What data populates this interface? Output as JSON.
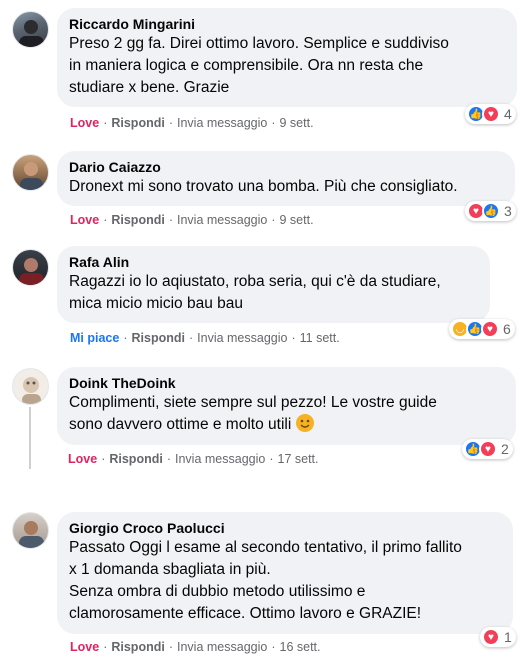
{
  "comments": [
    {
      "author": "Riccardo Mingarini",
      "lines": [
        "Preso 2 gg fa. Direi ottimo lavoro. Semplice e suddiviso",
        "in maniera logica e comprensibile. Ora nn resta che",
        "studiare x bene. Grazie"
      ],
      "reaction_label": "Love",
      "reply": "Rispondi",
      "message": "Invia messaggio",
      "time": "9 sett.",
      "reaction_icons": [
        "like-icon",
        "love-icon"
      ],
      "reaction_count": "4"
    },
    {
      "author": "Dario Caiazzo",
      "lines": [
        "Dronext mi sono trovato una bomba. Più che consigliato."
      ],
      "reaction_label": "Love",
      "reply": "Rispondi",
      "message": "Invia messaggio",
      "time": "9 sett.",
      "reaction_icons": [
        "love-icon",
        "like-icon"
      ],
      "reaction_count": "3"
    },
    {
      "author": "Rafa Alin",
      "lines": [
        "Ragazzi io lo aqiustato, roba seria, qui c'è da studiare,",
        "mica micio micio bau bau"
      ],
      "reaction_label": "Mi piace",
      "reply": "Rispondi",
      "message": "Invia messaggio",
      "time": "11 sett.",
      "reaction_icons": [
        "haha-icon",
        "like-icon",
        "love-icon"
      ],
      "reaction_count": "6"
    },
    {
      "author": "Doink TheDoink",
      "lines": [
        "Complimenti, siete sempre sul pezzo! Le vostre guide",
        "sono davvero ottime e molto utili"
      ],
      "reaction_label": "Love",
      "reply": "Rispondi",
      "message": "Invia messaggio",
      "time": "17 sett.",
      "reaction_icons": [
        "like-icon",
        "love-icon"
      ],
      "reaction_count": "2"
    },
    {
      "author": "Giorgio Croco Paolucci",
      "lines": [
        "Passato Oggi l esame al secondo tentativo, il primo fallito",
        "x 1 domanda sbagliata in più.",
        "Senza ombra di dubbio metodo utilissimo e",
        "clamorosamente efficace. Ottimo lavoro e GRAZIE!"
      ],
      "reaction_label": "Love",
      "reply": "Rispondi",
      "message": "Invia messaggio",
      "time": "16 sett.",
      "reaction_icons": [
        "love-icon"
      ],
      "reaction_count": "1"
    }
  ],
  "colors": {
    "bubble": "#f0f2f5",
    "love": "#e0245e",
    "like": "#1877f2",
    "meta": "#65676b"
  }
}
